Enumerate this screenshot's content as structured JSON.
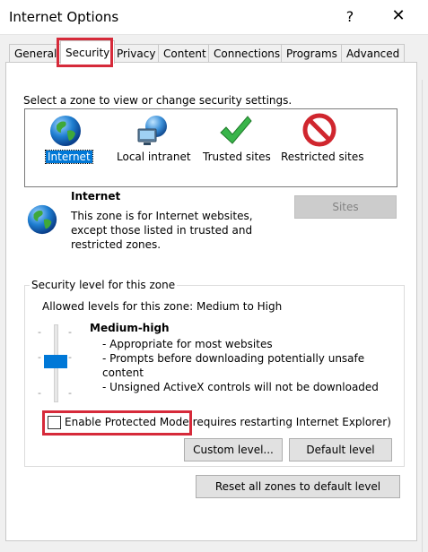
{
  "window": {
    "title": "Internet Options",
    "help": "?",
    "close": "✕"
  },
  "tabs": [
    {
      "label": "General",
      "active": false
    },
    {
      "label": "Security",
      "active": true
    },
    {
      "label": "Privacy",
      "active": false
    },
    {
      "label": "Content",
      "active": false
    },
    {
      "label": "Connections",
      "active": false
    },
    {
      "label": "Programs",
      "active": false
    },
    {
      "label": "Advanced",
      "active": false
    }
  ],
  "zones": {
    "prompt": "Select a zone to view or change security settings.",
    "items": [
      {
        "label": "Internet",
        "icon": "globe-icon",
        "selected": true
      },
      {
        "label": "Local intranet",
        "icon": "network-icon",
        "selected": false
      },
      {
        "label": "Trusted sites",
        "icon": "checkmark-icon",
        "selected": false
      },
      {
        "label": "Restricted sites",
        "icon": "no-entry-icon",
        "selected": false
      }
    ]
  },
  "selected_zone": {
    "name": "Internet",
    "description_lines": [
      "This zone is for Internet websites,",
      "except those listed in trusted and",
      "restricted zones."
    ],
    "sites_button": "Sites"
  },
  "security_level": {
    "group_title": "Security level for this zone",
    "allowed_levels": "Allowed levels for this zone: Medium to High",
    "level_name": "Medium-high",
    "level_fraction": 0.5,
    "bullets": [
      "- Appropriate for most websites",
      "- Prompts before downloading potentially unsafe",
      "content",
      "- Unsigned ActiveX controls will not be downloaded"
    ],
    "tick": "-",
    "protected_mode_label": "Enable Protected Mode",
    "protected_mode_note": "(requires restarting Internet Explorer)",
    "protected_mode_checked": false,
    "custom_level_button": "Custom level...",
    "default_level_button": "Default level"
  },
  "reset_button": "Reset all zones to default level",
  "colors": {
    "selection": "#0078d7",
    "highlight_red": "#d62a3a"
  }
}
